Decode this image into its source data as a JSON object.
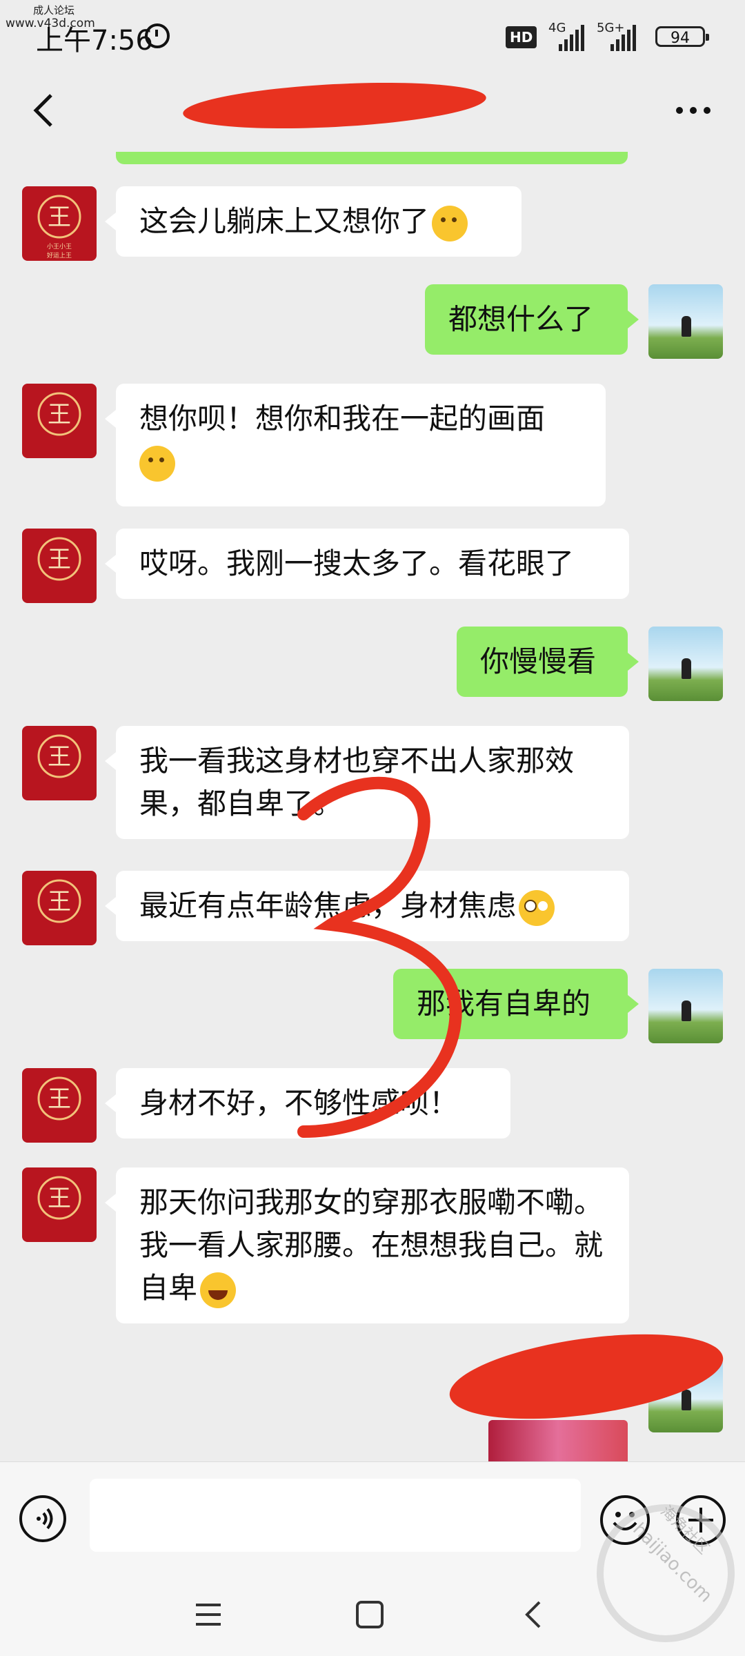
{
  "status_bar": {
    "site_tag": "成人论坛",
    "site_url": "www.v43d.com",
    "time": "上午7:56",
    "hd_badge": "HD",
    "net1": "4G",
    "net2": "5G+",
    "battery": "94"
  },
  "header": {
    "back_icon": "chevron-left-icon",
    "more_icon": "ellipsis-icon"
  },
  "contact_avatar": {
    "glyph": "王",
    "caption1": "小王小王",
    "caption2": "好运上王"
  },
  "messages": [
    {
      "side": "left",
      "text": "这会儿躺床上又想你了",
      "emoji": "thinking-face"
    },
    {
      "side": "right",
      "text": "都想什么了"
    },
    {
      "side": "left",
      "text": "想你呗！想你和我在一起的画面",
      "emoji": "thinking-face"
    },
    {
      "side": "left",
      "text": "哎呀。我刚一搜太多了。看花眼了"
    },
    {
      "side": "right",
      "text": "你慢慢看"
    },
    {
      "side": "left",
      "text": "我一看我这身材也穿不出人家那效果，都自卑了。"
    },
    {
      "side": "left",
      "text": "最近有点年龄焦虑，身材焦虑",
      "emoji": "eye-roll-face"
    },
    {
      "side": "right",
      "text": "那我有自卑的"
    },
    {
      "side": "left",
      "text": "身材不好，不够性感呗！"
    },
    {
      "side": "left",
      "text": "那天你问我那女的穿那衣服嘞不嘞。我一看人家那腰。在想想我自己。就自卑",
      "emoji": "laughing-tears-face"
    }
  ],
  "colors": {
    "background": "#ededed",
    "bubble_self": "#95ec69",
    "bubble_other": "#ffffff",
    "scribble": "#e8321f"
  },
  "input_bar": {
    "voice_icon": "voice-icon",
    "emoji_icon": "smiley-icon",
    "plus_icon": "plus-circle-icon",
    "input_value": ""
  },
  "nav_bar": {
    "menu_icon": "menu-icon",
    "home_icon": "home-square-icon",
    "back_icon": "back-triangle-icon"
  },
  "watermark": {
    "text": "haijiao.com",
    "text2": "海角社区"
  }
}
